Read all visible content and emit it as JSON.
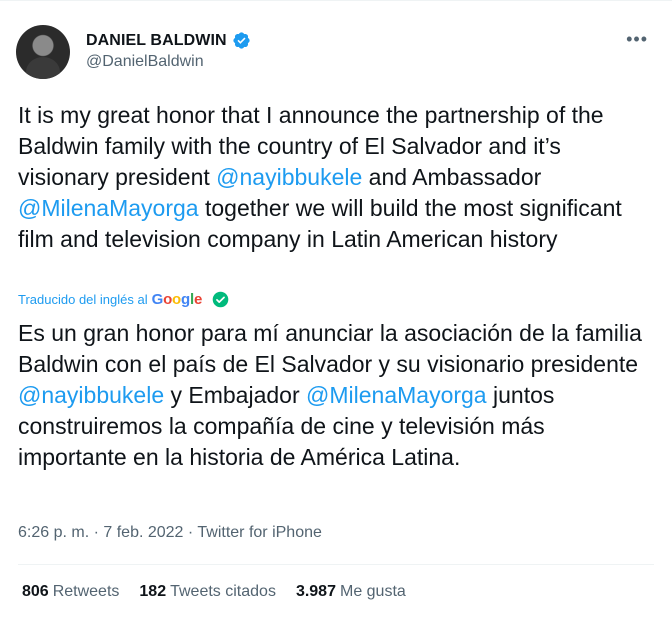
{
  "author": {
    "name": "DANIEL BALDWIN",
    "handle": "@DanielBaldwin"
  },
  "more_icon": "more-horizontal-icon",
  "tweet": {
    "original_parts": [
      "It is my great honor that I announce the partnership of the Baldwin family with the country of El Salvador and it’s visionary president ",
      "@nayibbukele",
      " and Ambassador ",
      "@MilenaMayorga",
      " together we will build the most significant film and television company in Latin American history"
    ],
    "translation_label": "Traducido del inglés al",
    "translation_brand": "Google",
    "translated_parts": [
      "Es un gran honor para mí anunciar la asociación de la familia Baldwin con el país de El Salvador y su visionario presidente ",
      "@nayibbukele",
      " y Embajador ",
      "@MilenaMayorga",
      " juntos construiremos la compañía de cine y televisión más importante en la historia de América Latina."
    ]
  },
  "meta": {
    "time": "6:26 p. m.",
    "separator": " · ",
    "date": "7 feb. 2022",
    "source": "Twitter for iPhone"
  },
  "stats": {
    "retweets_count": "806",
    "retweets_label": "Retweets",
    "quotes_count": "182",
    "quotes_label": "Tweets citados",
    "likes_count": "3.987",
    "likes_label": "Me gusta"
  },
  "colors": {
    "accent": "#1d9bf0",
    "secondary_text": "#536471",
    "verified": "#1d9bf0",
    "translation_check": "#00ba7c"
  }
}
